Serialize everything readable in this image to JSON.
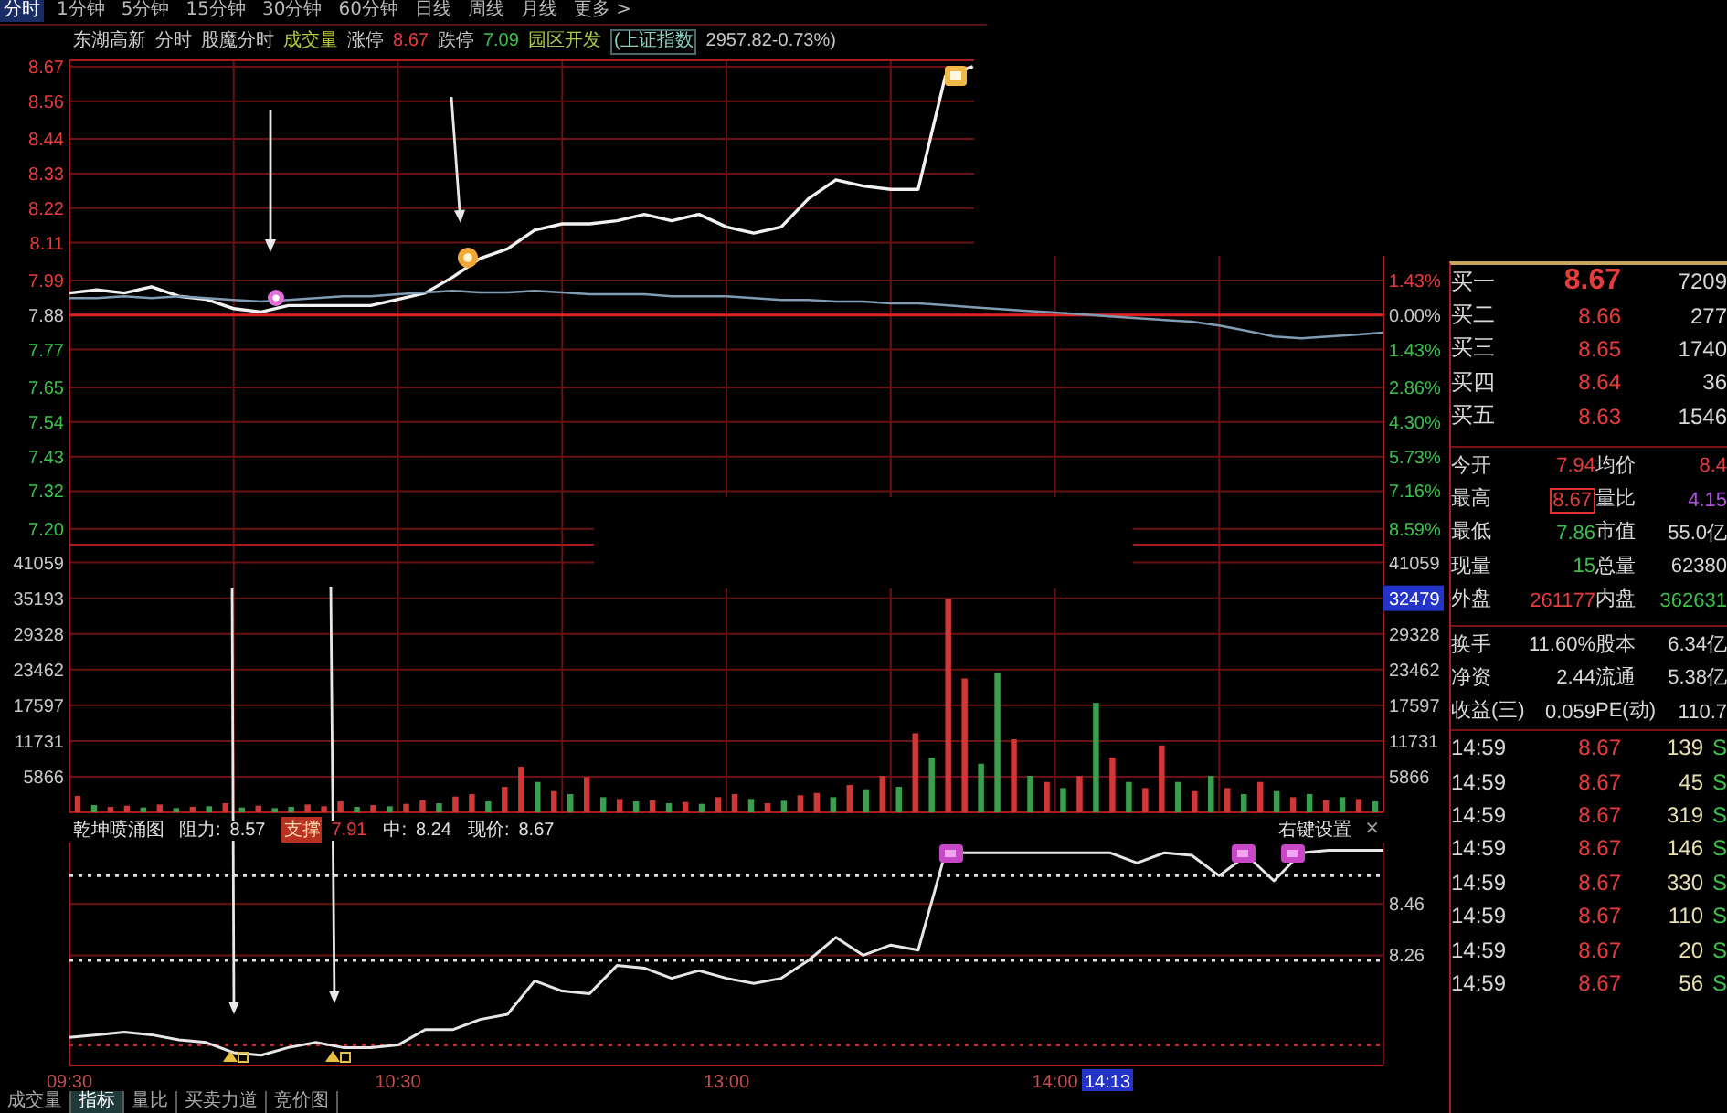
{
  "toolbar": {
    "tabs": [
      {
        "label": "分时",
        "selected": true
      },
      {
        "label": "1分钟",
        "selected": false
      },
      {
        "label": "5分钟",
        "selected": false
      },
      {
        "label": "15分钟",
        "selected": false
      },
      {
        "label": "30分钟",
        "selected": false
      },
      {
        "label": "60分钟",
        "selected": false
      },
      {
        "label": "日线",
        "selected": false
      },
      {
        "label": "周线",
        "selected": false
      },
      {
        "label": "月线",
        "selected": false
      },
      {
        "label": "更多 >",
        "selected": false
      }
    ]
  },
  "quote_header": {
    "items": [
      {
        "text": "东湖高新",
        "kind": "name"
      },
      {
        "text": "分时",
        "kind": "plain"
      },
      {
        "text": "股魔分时",
        "kind": "plain"
      },
      {
        "text": "成交量",
        "kind": "volume"
      },
      {
        "text": "涨停",
        "kind": "plain"
      },
      {
        "text": "8.67",
        "kind": "up"
      },
      {
        "text": "跌停",
        "kind": "plain"
      },
      {
        "text": "7.09",
        "kind": "down"
      },
      {
        "text": "园区开发",
        "kind": "sector"
      },
      {
        "text": "(上证指数",
        "kind": "index"
      },
      {
        "text": "2957.82-0.73%)",
        "kind": "plain"
      }
    ]
  },
  "price_panel": {
    "chart_data": {
      "type": "line",
      "categories": [
        null,
        null,
        null,
        null,
        null,
        null,
        null,
        null,
        null,
        null,
        null,
        null,
        null,
        null,
        null,
        null,
        null,
        null,
        null,
        null,
        null,
        null,
        null,
        null,
        null,
        null,
        null,
        null,
        null,
        null,
        null,
        null,
        null,
        null,
        null,
        null,
        null,
        null,
        null,
        null,
        null,
        null,
        null,
        null,
        null,
        null,
        null,
        null,
        null
      ],
      "series": [
        {
          "color": "#f2f2f2",
          "values": [
            7.95,
            7.96,
            7.95,
            7.97,
            7.94,
            7.93,
            7.9,
            7.89,
            7.91,
            7.91,
            7.91,
            7.91,
            7.93,
            7.95,
            8.0,
            8.06,
            8.09,
            8.15,
            8.17,
            8.17,
            8.18,
            8.2,
            8.18,
            8.2,
            8.16,
            8.14,
            8.16,
            8.25,
            8.31,
            8.29,
            8.28,
            8.28,
            8.64,
            8.67,
            null,
            null,
            null,
            null,
            null,
            null,
            null,
            null,
            null,
            null,
            null,
            null,
            null,
            null,
            null
          ]
        },
        {
          "color": "#7f9cb4",
          "values": [
            7.934,
            7.934,
            7.94,
            7.934,
            7.94,
            7.934,
            7.928,
            7.923,
            7.928,
            7.934,
            7.94,
            7.94,
            7.946,
            7.952,
            7.957,
            7.952,
            7.952,
            7.957,
            7.952,
            7.946,
            7.946,
            7.946,
            7.94,
            7.94,
            7.94,
            7.934,
            7.928,
            7.928,
            7.923,
            7.923,
            7.917,
            7.917,
            7.911,
            7.905,
            7.899,
            7.893,
            7.888,
            7.882,
            7.876,
            7.87,
            7.864,
            7.859,
            7.847,
            7.83,
            7.812,
            7.806,
            7.812,
            7.818,
            7.824
          ]
        }
      ],
      "ylim": [
        7.15,
        8.69
      ],
      "yticks": [
        8.67,
        8.56,
        8.44,
        8.33,
        8.22,
        8.11,
        7.99,
        7.88,
        7.77,
        7.65,
        7.54,
        7.43,
        7.32,
        {
          "value": 7.2,
          "label": "7.20"
        }
      ],
      "grid": true,
      "ref_lines": [
        {
          "axis": "y",
          "value": 7.88,
          "color": "#e02424"
        }
      ]
    },
    "right_labels": [
      "1.43%",
      "0.00%",
      "1.43%",
      "2.86%",
      "4.30%",
      "5.73%",
      "7.16%",
      "8.59%"
    ]
  },
  "volume_panel": {
    "chart_data": {
      "type": "bar",
      "categories": [
        null,
        null,
        null,
        null,
        null,
        null,
        null,
        null,
        null,
        null,
        null,
        null,
        null,
        null,
        null,
        null,
        null,
        null,
        null,
        null,
        null,
        null,
        null,
        null,
        null,
        null,
        null,
        null,
        null,
        null,
        null,
        null,
        null,
        null,
        null,
        null,
        null,
        null,
        null,
        null,
        null,
        null,
        null,
        null,
        null,
        null,
        null,
        null,
        null,
        null,
        null,
        null,
        null,
        null,
        null,
        null,
        null,
        null,
        null,
        null,
        null,
        null,
        null,
        null,
        null,
        null,
        null,
        null,
        null,
        null,
        null,
        null,
        null,
        null,
        null,
        null,
        null,
        null,
        null,
        null
      ],
      "series": [
        {
          "color": "#d03838",
          "values": [
            2700,
            null,
            900,
            1100,
            null,
            1300,
            null,
            900,
            null,
            1500,
            null,
            1100,
            null,
            null,
            1300,
            1000,
            1800,
            null,
            1200,
            null,
            1400,
            2000,
            null,
            2600,
            3000,
            null,
            4200,
            7500,
            null,
            3500,
            null,
            5800,
            null,
            2200,
            null,
            2000,
            null,
            1700,
            null,
            2500,
            3000,
            null,
            1500,
            null,
            2800,
            3200,
            null,
            4500,
            null,
            6000,
            null,
            13000,
            null,
            35000,
            22000,
            null,
            null,
            12000,
            null,
            5000,
            null,
            6000,
            null,
            9000,
            null,
            4000,
            11000,
            null,
            3500,
            null,
            4000,
            null,
            5000,
            null,
            2500,
            null,
            2000,
            null,
            2200,
            null
          ]
        },
        {
          "color": "#3aa050",
          "values": [
            null,
            1200,
            null,
            null,
            800,
            null,
            700,
            null,
            1000,
            null,
            800,
            null,
            700,
            900,
            null,
            null,
            null,
            900,
            null,
            1000,
            null,
            null,
            1500,
            null,
            null,
            1800,
            null,
            null,
            5000,
            null,
            3000,
            null,
            2500,
            null,
            1800,
            null,
            1500,
            null,
            1400,
            null,
            null,
            2200,
            null,
            1900,
            null,
            null,
            2500,
            null,
            3800,
            null,
            4200,
            null,
            9000,
            null,
            null,
            8000,
            23000,
            null,
            6000,
            null,
            4000,
            null,
            18000,
            null,
            5000,
            null,
            null,
            5000,
            null,
            6000,
            null,
            3000,
            null,
            3500,
            null,
            3000,
            null,
            2500,
            null,
            1800
          ]
        }
      ],
      "ylim": [
        0,
        44000
      ],
      "yticks": [
        41059,
        35193,
        29328,
        23462,
        17597,
        11731,
        5866
      ],
      "grid": true
    },
    "right_labels": [
      {
        "text": "41059",
        "highlighted": false
      },
      {
        "text": "32479",
        "highlighted": true
      },
      {
        "text": "29328",
        "highlighted": false
      },
      {
        "text": "23462",
        "highlighted": false
      },
      {
        "text": "17597",
        "highlighted": false
      },
      {
        "text": "11731",
        "highlighted": false
      },
      {
        "text": "5866",
        "highlighted": false
      }
    ]
  },
  "indicator_panel": {
    "title": "乾坤喷涌图",
    "legend": [
      {
        "label": "阻力:",
        "value": "8.57",
        "kind": "resistance"
      },
      {
        "label": "支撑",
        "value": "7.91",
        "kind": "support"
      },
      {
        "label": "中:",
        "value": "8.24",
        "kind": "middle"
      },
      {
        "label": "现价:",
        "value": "8.67",
        "kind": "price"
      }
    ],
    "settings": "右键设置",
    "close": "×",
    "cursor_time": "14:13",
    "chart_data": {
      "type": "line",
      "categories": [
        "09:30",
        null,
        null,
        null,
        null,
        null,
        null,
        null,
        null,
        null,
        null,
        null,
        "10:30",
        null,
        null,
        null,
        null,
        null,
        null,
        null,
        null,
        null,
        null,
        null,
        "13:00",
        null,
        null,
        null,
        null,
        null,
        null,
        null,
        null,
        null,
        null,
        null,
        "14:00",
        null,
        null,
        null,
        null,
        null,
        null,
        null,
        null,
        null,
        null,
        null,
        null
      ],
      "series": [
        {
          "color": "#e6e6e6",
          "values": [
            7.94,
            7.95,
            7.96,
            7.95,
            7.93,
            7.92,
            7.88,
            7.87,
            7.9,
            7.92,
            7.9,
            7.9,
            7.91,
            7.97,
            7.97,
            8.01,
            8.03,
            8.16,
            8.12,
            8.11,
            8.22,
            8.21,
            8.17,
            8.2,
            8.17,
            8.15,
            8.17,
            8.24,
            8.33,
            8.26,
            8.3,
            8.28,
            8.66,
            8.66,
            8.66,
            8.66,
            8.66,
            8.66,
            8.66,
            8.62,
            8.66,
            8.65,
            8.57,
            8.65,
            8.55,
            8.66,
            8.67,
            8.67,
            8.67
          ]
        }
      ],
      "ylim": [
        7.83,
        8.7
      ],
      "yticks": [
        8.46,
        8.26
      ],
      "ref_lines": [
        {
          "axis": "y",
          "value": 8.57,
          "color": "#e0e0e0"
        },
        {
          "axis": "y",
          "value": 8.24,
          "color": "#e0e0e0"
        },
        {
          "axis": "y",
          "value": 7.91,
          "color": "#c02828"
        }
      ]
    }
  },
  "bottom_tabs": [
    {
      "label": "成交量",
      "selected": false
    },
    {
      "label": "指标",
      "selected": true
    },
    {
      "label": "量比",
      "selected": false
    },
    {
      "label": "买卖力道",
      "selected": false
    },
    {
      "label": "竞价图",
      "selected": false
    }
  ],
  "quote_panel": {
    "bids": [
      {
        "label": "买一",
        "price": "8.67",
        "volume": "7209"
      },
      {
        "label": "买二",
        "price": "8.66",
        "volume": "277"
      },
      {
        "label": "买三",
        "price": "8.65",
        "volume": "1740"
      },
      {
        "label": "买四",
        "price": "8.64",
        "volume": "36"
      },
      {
        "label": "买五",
        "price": "8.63",
        "volume": "1546"
      }
    ],
    "stats": [
      {
        "label": "今开",
        "value": "7.94",
        "kind": "up",
        "highlighted": false
      },
      {
        "label": "均价",
        "value": "8.4",
        "kind": "up",
        "highlighted": false
      },
      {
        "label": "最高",
        "value": "8.67",
        "kind": "up",
        "highlighted": true
      },
      {
        "label": "量比",
        "value": "4.15",
        "kind": "ratio",
        "highlighted": false
      },
      {
        "label": "最低",
        "value": "7.86",
        "kind": "down",
        "highlighted": false
      },
      {
        "label": "市值",
        "value": "55.0亿",
        "kind": "flat",
        "highlighted": false
      },
      {
        "label": "现量",
        "value": "15",
        "kind": "down",
        "highlighted": false
      },
      {
        "label": "总量",
        "value": "62380",
        "kind": "flat",
        "highlighted": false
      },
      {
        "label": "外盘",
        "value": "261177",
        "kind": "up",
        "highlighted": false
      },
      {
        "label": "内盘",
        "value": "362631",
        "kind": "down",
        "highlighted": false
      }
    ],
    "details": [
      {
        "label": "换手",
        "value": "11.60%"
      },
      {
        "label": "股本",
        "value": "6.34亿"
      },
      {
        "label": "净资",
        "value": "2.44"
      },
      {
        "label": "流通",
        "value": "5.38亿"
      },
      {
        "label": "收益(三)",
        "value": "0.059"
      },
      {
        "label": "PE(动)",
        "value": "110.7"
      }
    ],
    "trades": [
      {
        "time": "14:59",
        "price": "8.67",
        "volume": "139",
        "side": "S"
      },
      {
        "time": "14:59",
        "price": "8.67",
        "volume": "45",
        "side": "S"
      },
      {
        "time": "14:59",
        "price": "8.67",
        "volume": "319",
        "side": "S"
      },
      {
        "time": "14:59",
        "price": "8.67",
        "volume": "146",
        "side": "S"
      },
      {
        "time": "14:59",
        "price": "8.67",
        "volume": "330",
        "side": "S"
      },
      {
        "time": "14:59",
        "price": "8.67",
        "volume": "110",
        "side": "S"
      },
      {
        "time": "14:59",
        "price": "8.67",
        "volume": "20",
        "side": "S"
      },
      {
        "time": "14:59",
        "price": "8.67",
        "volume": "56",
        "side": "S"
      }
    ]
  }
}
